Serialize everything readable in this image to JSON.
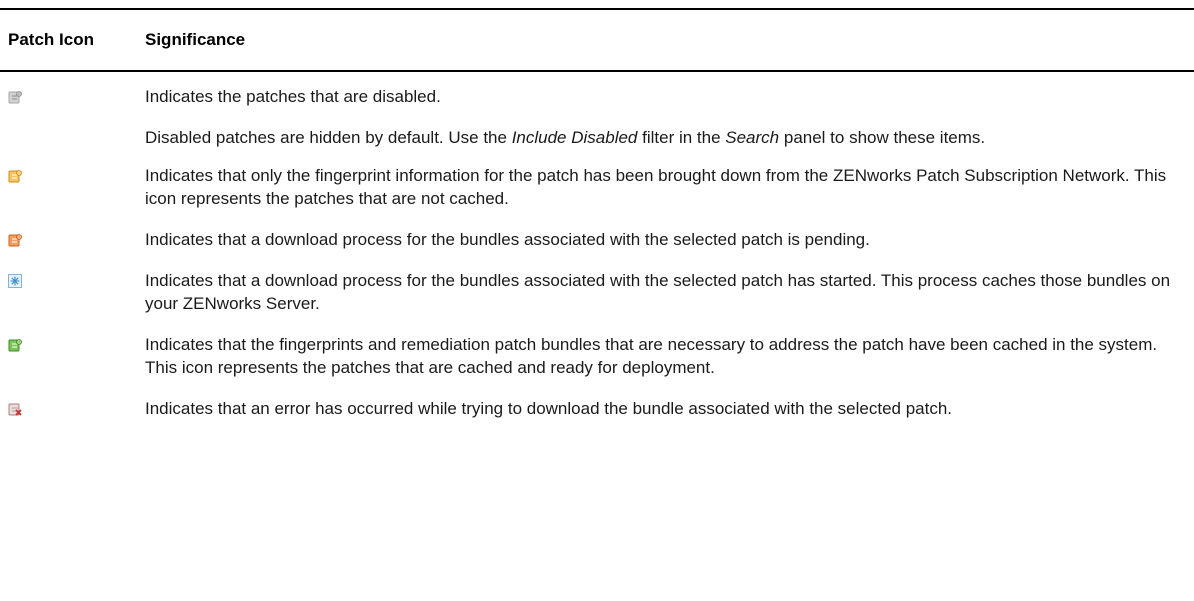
{
  "header": {
    "col_icon": "Patch Icon",
    "col_significance": "Significance"
  },
  "rows": [
    {
      "icon": "disabled-patch-icon",
      "color": "#b0b0b0",
      "paragraphs": [
        "Indicates the patches that are disabled.",
        {
          "before": "Disabled patches are hidden by default. Use the ",
          "em1": "Include Disabled",
          "mid": " filter in the ",
          "em2": "Search",
          "after": " panel to show these items."
        }
      ]
    },
    {
      "icon": "not-cached-patch-icon",
      "color": "#f2b13a",
      "paragraphs": [
        "Indicates that only the fingerprint information for the patch has been brought down from the ZENworks Patch Subscription Network. This icon represents the patches that are not cached."
      ]
    },
    {
      "icon": "download-pending-patch-icon",
      "color": "#e8823a",
      "paragraphs": [
        "Indicates that a download process for the bundles associated with the selected patch is pending."
      ]
    },
    {
      "icon": "download-started-patch-icon",
      "color": "#5aa6d6",
      "paragraphs": [
        "Indicates that a download process for the bundles associated with the selected patch has started. This process caches those bundles on your ZENworks Server."
      ]
    },
    {
      "icon": "cached-patch-icon",
      "color": "#5fae3c",
      "paragraphs": [
        "Indicates that the fingerprints and remediation patch bundles that are necessary to address the patch have been cached in the system. This icon represents the patches that are cached and ready for deployment."
      ]
    },
    {
      "icon": "error-patch-icon",
      "color": "#d9474a",
      "paragraphs": [
        "Indicates that an error has occurred while trying to download the bundle associated with the selected patch."
      ]
    }
  ]
}
